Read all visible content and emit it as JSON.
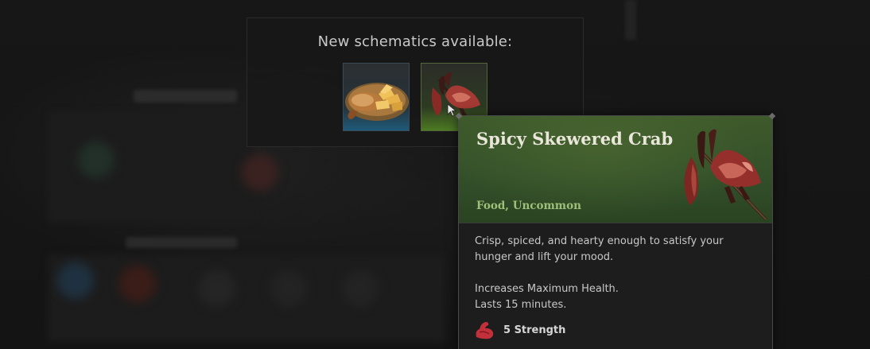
{
  "notification": {
    "title": "New schematics available:",
    "items": [
      {
        "name": "roasted-fish-with-potatoes",
        "rarity": "common",
        "icon": "plate-food-icon"
      },
      {
        "name": "spicy-skewered-crab",
        "rarity": "uncommon",
        "icon": "crab-skewer-icon"
      }
    ]
  },
  "tooltip": {
    "name": "Spicy Skewered Crab",
    "type": "Food, Uncommon",
    "description": "Crisp, spiced, and hearty enough to satisfy your hunger and lift your mood.",
    "effect_line1": "Increases Maximum Health.",
    "effect_line2": "Lasts 15 minutes.",
    "stat": {
      "label": "5 Strength",
      "icon": "flexed-arm-icon"
    }
  },
  "colors": {
    "uncommon": "#4c7a22",
    "common": "#1f5a7a",
    "type_text": "#9cc07a",
    "stat_icon": "#c2303a"
  }
}
